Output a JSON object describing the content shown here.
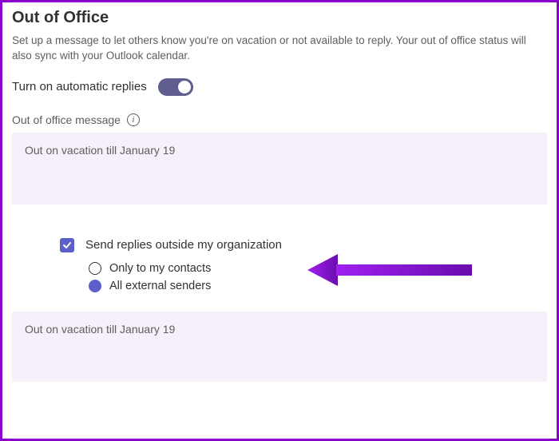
{
  "title": "Out of Office",
  "description": "Set up a message to let others know you're on vacation or not available to reply. Your out of office status will also sync with your Outlook calendar.",
  "toggle": {
    "label": "Turn on automatic replies",
    "on": true
  },
  "messageSection": {
    "label": "Out of office message",
    "value": "Out on vacation till January 19"
  },
  "externalReplies": {
    "checkboxLabel": "Send replies outside my organization",
    "checked": true,
    "options": {
      "contacts": "Only to my contacts",
      "all": "All external senders"
    },
    "selected": "all",
    "messageValue": "Out on vacation till January 19"
  }
}
